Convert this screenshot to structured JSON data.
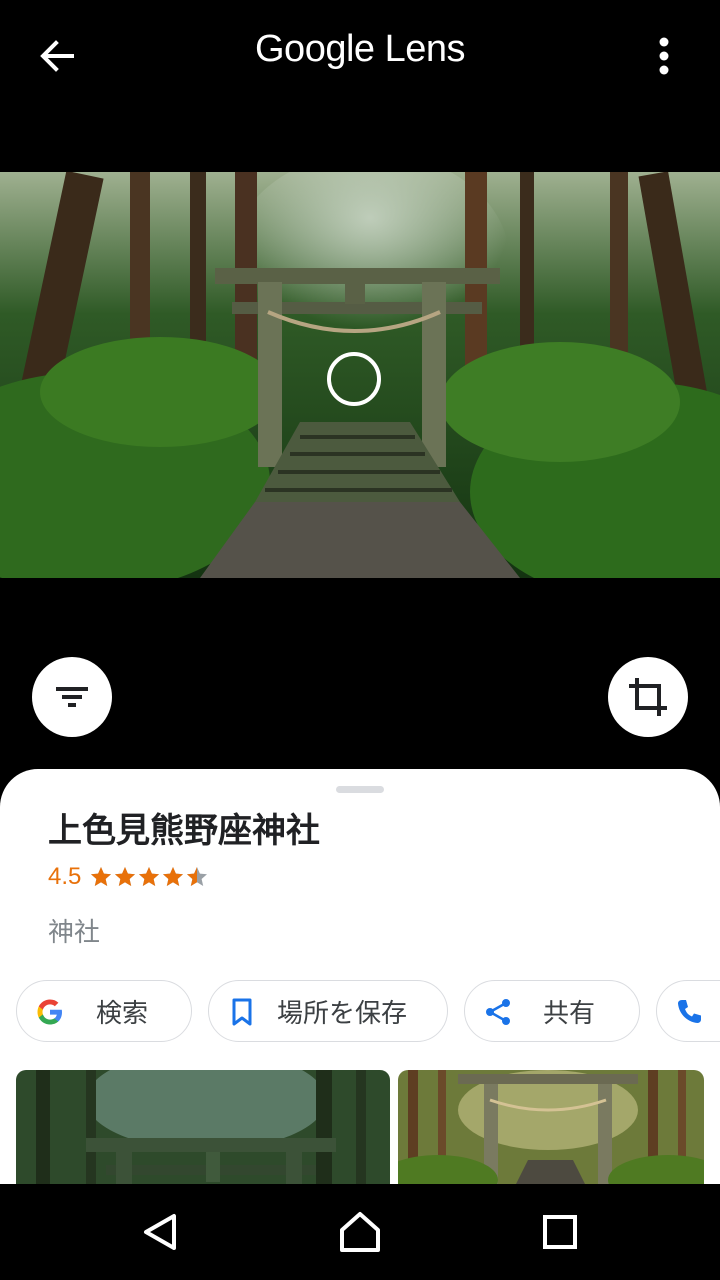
{
  "app": {
    "title": "Google Lens"
  },
  "icons": {
    "back": "arrow-left-icon",
    "menu": "more-vertical-icon",
    "filter": "filter-icon",
    "crop": "crop-icon"
  },
  "place": {
    "name": "上色見熊野座神社",
    "rating": "4.5",
    "stars": 4.5,
    "category": "神社"
  },
  "chips": [
    {
      "label": "検索",
      "icon": "google-g-icon"
    },
    {
      "label": "場所を保存",
      "icon": "bookmark-icon"
    },
    {
      "label": "共有",
      "icon": "share-icon"
    },
    {
      "label": "",
      "icon": "phone-icon"
    }
  ],
  "colors": {
    "accent_blue": "#1a73e8",
    "rating_orange": "#e8710a",
    "category_gray": "#80868b"
  },
  "nav": {
    "back": "nav-back-icon",
    "home": "nav-home-icon",
    "recents": "nav-recents-icon"
  }
}
